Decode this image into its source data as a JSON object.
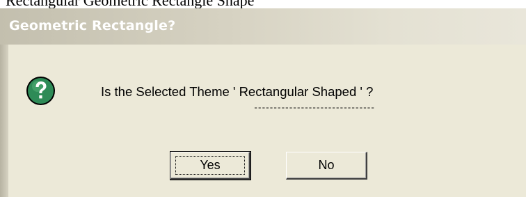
{
  "background_text": "Rectangular Geometric Rectangle Shape",
  "dialog": {
    "title": "Geometric Rectangle?",
    "icon": "question-icon",
    "message": "Is the Selected Theme ' Rectangular Shaped ' ?",
    "underline_mark": "-------------------------------",
    "buttons": {
      "yes_label": "Yes",
      "no_label": "No"
    }
  },
  "colors": {
    "dialog_face": "#ece9d8",
    "icon_green": "#2e8b57",
    "title_text": "#ffffff"
  }
}
